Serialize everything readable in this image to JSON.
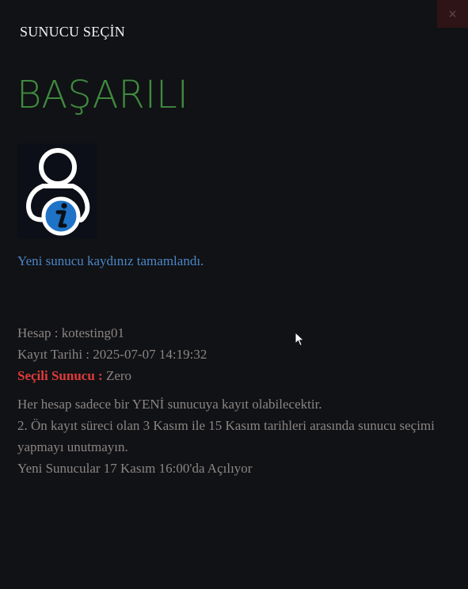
{
  "close_label": "×",
  "header": {
    "title": "SUNUCU SEÇİN"
  },
  "status": {
    "title": "BAŞARILI",
    "icon": "user-info-icon",
    "message": "Yeni sunucu kaydınız tamamlandı."
  },
  "account": {
    "hesap_label": "Hesap :",
    "hesap_value": "kotesting01",
    "kayit_label": "Kayıt Tarihi :",
    "kayit_value": "2025-07-07 14:19:32",
    "secili_label": "Seçili Sunucu :",
    "secili_value": "Zero"
  },
  "notes": {
    "line1": "Her hesap sadece bir YENİ sunucuya kayıt olabilecektir.",
    "line2": "2. Ön kayıt süreci olan 3 Kasım ile 15 Kasım tarihleri arasında sunucu seçimi yapmayı unutmayın.",
    "line3": "Yeni Sunucular 17 Kasım 16:00'da Açılıyor"
  },
  "colors": {
    "background": "#111215",
    "success_green": "#3f8a3f",
    "message_blue": "#4a86c8",
    "text_gray": "#8b8583",
    "label_red": "#e03b3b",
    "info_blue": "#1f73c6"
  }
}
